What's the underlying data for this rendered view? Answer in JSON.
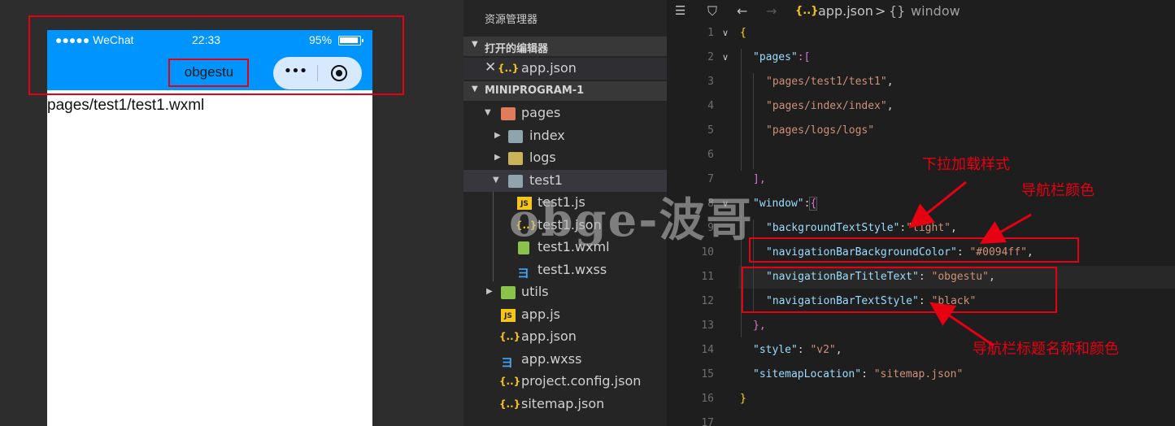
{
  "simulator": {
    "status": {
      "carrier": "●●●●● WeChat",
      "time": "22:33",
      "battery": "95%"
    },
    "nav_title": "obgestu",
    "capsule_dots": "•••",
    "page_text": "pages/test1/test1.wxml"
  },
  "explorer": {
    "title": "资源管理器",
    "open_editors_label": "打开的编辑器",
    "open_file": "app.json",
    "project_label": "MINIPROGRAM-1",
    "tree": [
      "pages",
      "index",
      "logs",
      "test1",
      "test1.js",
      "test1.json",
      "test1.wxml",
      "test1.wxss",
      "utils",
      "app.js",
      "app.json",
      "app.wxss",
      "project.config.json",
      "sitemap.json"
    ],
    "icon_json": "{..}",
    "icon_js": "JS",
    "icon_wxss": "ヨ"
  },
  "editor": {
    "breadcrumb": {
      "file": "app.json",
      "sep": ">",
      "node_icon": "{}",
      "node": "window"
    },
    "line_numbers": [
      "1",
      "2",
      "3",
      "4",
      "5",
      "6",
      "7",
      "8",
      "9",
      "10",
      "11",
      "12",
      "13",
      "14",
      "15",
      "16",
      "17"
    ],
    "lines": {
      "l1_open": "{",
      "l2_key": "\"pages\"",
      "l2_rest": ":[",
      "l3": "\"pages/test1/test1\"",
      "l4": "\"pages/index/index\"",
      "l5": "\"pages/logs/logs\"",
      "l7": "],",
      "l8_key": "\"window\"",
      "l8_colon": ":",
      "l8_brace": "{",
      "l9_key": "\"backgroundTextStyle\"",
      "l9_val": "\"light\"",
      "l10_key": "\"navigationBarBackgroundColor\"",
      "l10_val": "\"#0094ff\"",
      "l11_key": "\"navigationBarTitleText\"",
      "l11_val": "\"obgestu\"",
      "l12_key": "\"navigationBarTextStyle\"",
      "l12_val": "\"black\"",
      "l13": "},",
      "l14_key": "\"style\"",
      "l14_val": "\"v2\"",
      "l15_key": "\"sitemapLocation\"",
      "l15_val": "\"sitemap.json\"",
      "l16": "}",
      "colon": ": ",
      "colon_tight": ":",
      "comma": ","
    }
  },
  "annotations": {
    "pulldown_style": "下拉加载样式",
    "nav_color": "导航栏颜色",
    "nav_title_color": "导航栏标题名称和颜色",
    "watermark": "obge-波哥"
  },
  "colors": {
    "nav_bar": "#0094ff",
    "annotation_red": "#e60012",
    "editor_bg": "#1e1e1e",
    "sidebar_bg": "#252526"
  }
}
